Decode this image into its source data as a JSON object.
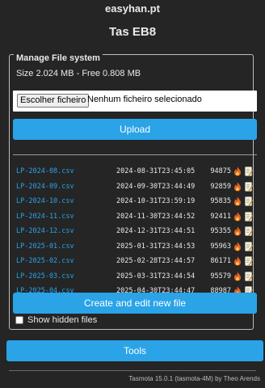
{
  "header": {
    "site": "easyhan.pt",
    "device": "Tas EB8"
  },
  "manage": {
    "legend": "Manage File system",
    "size_text": "Size 2.024 MB - Free 0.808 MB",
    "choose_label": "Escolher ficheiro",
    "no_file_text": "Nenhum ficheiro selecionado",
    "upload_label": "Upload",
    "files": [
      {
        "name": "LP-2024-08.csv",
        "date": "2024-08-31T23:45:05",
        "size": "94875"
      },
      {
        "name": "LP-2024-09.csv",
        "date": "2024-09-30T23:44:49",
        "size": "92859"
      },
      {
        "name": "LP-2024-10.csv",
        "date": "2024-10-31T23:59:19",
        "size": "95835"
      },
      {
        "name": "LP-2024-11.csv",
        "date": "2024-11-30T23:44:52",
        "size": "92411"
      },
      {
        "name": "LP-2024-12.csv",
        "date": "2024-12-31T23:44:51",
        "size": "95355"
      },
      {
        "name": "LP-2025-01.csv",
        "date": "2025-01-31T23:44:53",
        "size": "95963"
      },
      {
        "name": "LP-2025-02.csv",
        "date": "2025-02-28T23:44:57",
        "size": "86171"
      },
      {
        "name": "LP-2025-03.csv",
        "date": "2025-03-31T23:44:54",
        "size": "95579"
      },
      {
        "name": "LP-2025-04.csv",
        "date": "2025-04-30T23:44:47",
        "size": "88987"
      }
    ],
    "delete_icon": "fire-icon",
    "edit_icon": "edit-icon",
    "create_label": "Create and edit new file",
    "show_hidden_label": "Show hidden files"
  },
  "tools_label": "Tools",
  "footer": "Tasmota 15.0.1 (tasmota-4M) by Theo Arends",
  "colors": {
    "accent": "#2aa3e7",
    "background": "#252525",
    "text": "#eaeaea",
    "fire": "#e8622a"
  }
}
